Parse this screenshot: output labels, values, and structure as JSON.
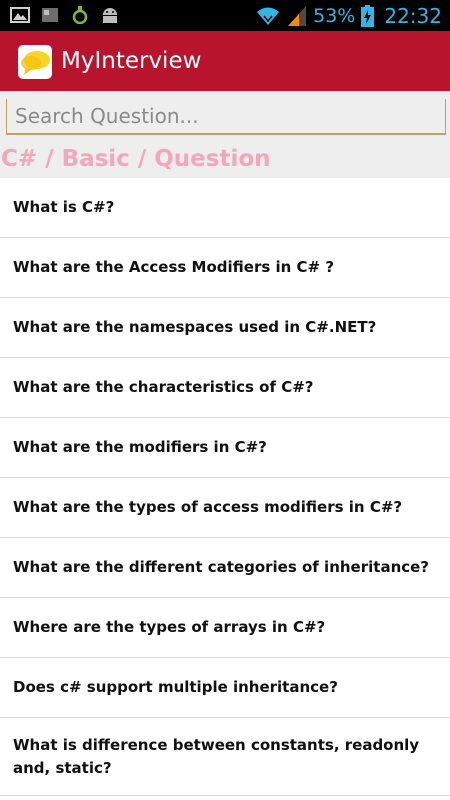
{
  "status_bar": {
    "battery": "53%",
    "clock": "22:32"
  },
  "app_bar": {
    "title": "MyInterview"
  },
  "search": {
    "placeholder": "Search Question..."
  },
  "breadcrumb": "C# / Basic / Question",
  "questions": [
    "What is C#?",
    "What are the Access Modifiers in C# ?",
    "What are the namespaces used in C#.NET?",
    "What are the characteristics of C#?",
    "What are the modifiers in C#?",
    "What are the types of access modifiers in C#?",
    "What are the different categories of inheritance?",
    "Where are the types of arrays in C#?",
    "Does c# support multiple inheritance?",
    "What is difference between constants, readonly and, static?"
  ],
  "colors": {
    "app_bar": "#b8142e",
    "breadcrumb": "#f4a6ba",
    "status_icons": "#33b5e5"
  }
}
